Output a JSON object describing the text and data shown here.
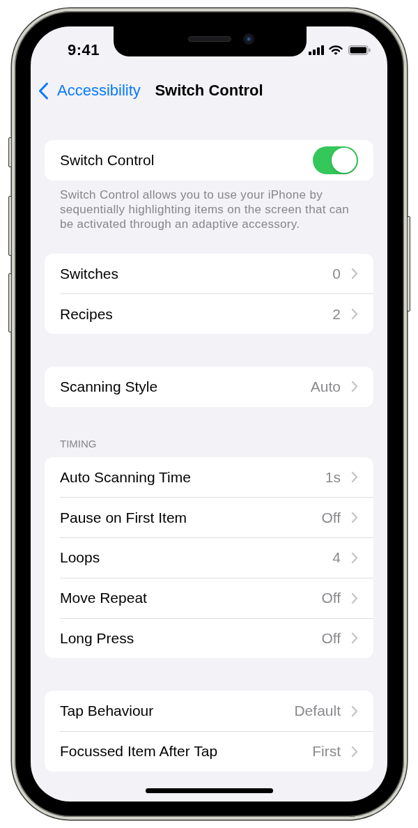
{
  "status_bar": {
    "time": "9:41"
  },
  "nav_bar": {
    "back_label": "Accessibility",
    "title": "Switch Control"
  },
  "sections": [
    {
      "rows": [
        {
          "kind": "toggle",
          "label": "Switch Control",
          "on": true
        }
      ],
      "footer": "Switch Control allows you to use your iPhone by sequentially highlighting items on the screen that can be activated through an adaptive accessory."
    },
    {
      "rows": [
        {
          "kind": "disclosure",
          "label": "Switches",
          "value": "0"
        },
        {
          "kind": "disclosure",
          "label": "Recipes",
          "value": "2"
        }
      ]
    },
    {
      "rows": [
        {
          "kind": "disclosure",
          "label": "Scanning Style",
          "value": "Auto"
        }
      ]
    },
    {
      "header": "TIMING",
      "rows": [
        {
          "kind": "disclosure",
          "label": "Auto Scanning Time",
          "value": "1s"
        },
        {
          "kind": "disclosure",
          "label": "Pause on First Item",
          "value": "Off"
        },
        {
          "kind": "disclosure",
          "label": "Loops",
          "value": "4"
        },
        {
          "kind": "disclosure",
          "label": "Move Repeat",
          "value": "Off"
        },
        {
          "kind": "disclosure",
          "label": "Long Press",
          "value": "Off"
        }
      ]
    },
    {
      "rows": [
        {
          "kind": "disclosure",
          "label": "Tap Behaviour",
          "value": "Default"
        },
        {
          "kind": "disclosure",
          "label": "Focussed Item After Tap",
          "value": "First"
        }
      ]
    }
  ]
}
